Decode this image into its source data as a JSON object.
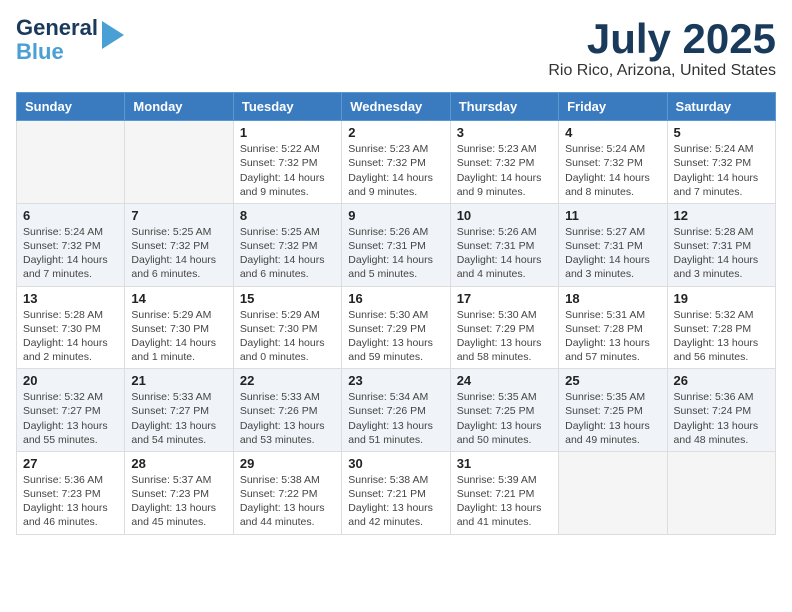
{
  "logo": {
    "line1": "General",
    "line2": "Blue"
  },
  "title": "July 2025",
  "location": "Rio Rico, Arizona, United States",
  "headers": [
    "Sunday",
    "Monday",
    "Tuesday",
    "Wednesday",
    "Thursday",
    "Friday",
    "Saturday"
  ],
  "weeks": [
    [
      {
        "day": "",
        "info": ""
      },
      {
        "day": "",
        "info": ""
      },
      {
        "day": "1",
        "info": "Sunrise: 5:22 AM\nSunset: 7:32 PM\nDaylight: 14 hours\nand 9 minutes."
      },
      {
        "day": "2",
        "info": "Sunrise: 5:23 AM\nSunset: 7:32 PM\nDaylight: 14 hours\nand 9 minutes."
      },
      {
        "day": "3",
        "info": "Sunrise: 5:23 AM\nSunset: 7:32 PM\nDaylight: 14 hours\nand 9 minutes."
      },
      {
        "day": "4",
        "info": "Sunrise: 5:24 AM\nSunset: 7:32 PM\nDaylight: 14 hours\nand 8 minutes."
      },
      {
        "day": "5",
        "info": "Sunrise: 5:24 AM\nSunset: 7:32 PM\nDaylight: 14 hours\nand 7 minutes."
      }
    ],
    [
      {
        "day": "6",
        "info": "Sunrise: 5:24 AM\nSunset: 7:32 PM\nDaylight: 14 hours\nand 7 minutes."
      },
      {
        "day": "7",
        "info": "Sunrise: 5:25 AM\nSunset: 7:32 PM\nDaylight: 14 hours\nand 6 minutes."
      },
      {
        "day": "8",
        "info": "Sunrise: 5:25 AM\nSunset: 7:32 PM\nDaylight: 14 hours\nand 6 minutes."
      },
      {
        "day": "9",
        "info": "Sunrise: 5:26 AM\nSunset: 7:31 PM\nDaylight: 14 hours\nand 5 minutes."
      },
      {
        "day": "10",
        "info": "Sunrise: 5:26 AM\nSunset: 7:31 PM\nDaylight: 14 hours\nand 4 minutes."
      },
      {
        "day": "11",
        "info": "Sunrise: 5:27 AM\nSunset: 7:31 PM\nDaylight: 14 hours\nand 3 minutes."
      },
      {
        "day": "12",
        "info": "Sunrise: 5:28 AM\nSunset: 7:31 PM\nDaylight: 14 hours\nand 3 minutes."
      }
    ],
    [
      {
        "day": "13",
        "info": "Sunrise: 5:28 AM\nSunset: 7:30 PM\nDaylight: 14 hours\nand 2 minutes."
      },
      {
        "day": "14",
        "info": "Sunrise: 5:29 AM\nSunset: 7:30 PM\nDaylight: 14 hours\nand 1 minute."
      },
      {
        "day": "15",
        "info": "Sunrise: 5:29 AM\nSunset: 7:30 PM\nDaylight: 14 hours\nand 0 minutes."
      },
      {
        "day": "16",
        "info": "Sunrise: 5:30 AM\nSunset: 7:29 PM\nDaylight: 13 hours\nand 59 minutes."
      },
      {
        "day": "17",
        "info": "Sunrise: 5:30 AM\nSunset: 7:29 PM\nDaylight: 13 hours\nand 58 minutes."
      },
      {
        "day": "18",
        "info": "Sunrise: 5:31 AM\nSunset: 7:28 PM\nDaylight: 13 hours\nand 57 minutes."
      },
      {
        "day": "19",
        "info": "Sunrise: 5:32 AM\nSunset: 7:28 PM\nDaylight: 13 hours\nand 56 minutes."
      }
    ],
    [
      {
        "day": "20",
        "info": "Sunrise: 5:32 AM\nSunset: 7:27 PM\nDaylight: 13 hours\nand 55 minutes."
      },
      {
        "day": "21",
        "info": "Sunrise: 5:33 AM\nSunset: 7:27 PM\nDaylight: 13 hours\nand 54 minutes."
      },
      {
        "day": "22",
        "info": "Sunrise: 5:33 AM\nSunset: 7:26 PM\nDaylight: 13 hours\nand 53 minutes."
      },
      {
        "day": "23",
        "info": "Sunrise: 5:34 AM\nSunset: 7:26 PM\nDaylight: 13 hours\nand 51 minutes."
      },
      {
        "day": "24",
        "info": "Sunrise: 5:35 AM\nSunset: 7:25 PM\nDaylight: 13 hours\nand 50 minutes."
      },
      {
        "day": "25",
        "info": "Sunrise: 5:35 AM\nSunset: 7:25 PM\nDaylight: 13 hours\nand 49 minutes."
      },
      {
        "day": "26",
        "info": "Sunrise: 5:36 AM\nSunset: 7:24 PM\nDaylight: 13 hours\nand 48 minutes."
      }
    ],
    [
      {
        "day": "27",
        "info": "Sunrise: 5:36 AM\nSunset: 7:23 PM\nDaylight: 13 hours\nand 46 minutes."
      },
      {
        "day": "28",
        "info": "Sunrise: 5:37 AM\nSunset: 7:23 PM\nDaylight: 13 hours\nand 45 minutes."
      },
      {
        "day": "29",
        "info": "Sunrise: 5:38 AM\nSunset: 7:22 PM\nDaylight: 13 hours\nand 44 minutes."
      },
      {
        "day": "30",
        "info": "Sunrise: 5:38 AM\nSunset: 7:21 PM\nDaylight: 13 hours\nand 42 minutes."
      },
      {
        "day": "31",
        "info": "Sunrise: 5:39 AM\nSunset: 7:21 PM\nDaylight: 13 hours\nand 41 minutes."
      },
      {
        "day": "",
        "info": ""
      },
      {
        "day": "",
        "info": ""
      }
    ]
  ]
}
